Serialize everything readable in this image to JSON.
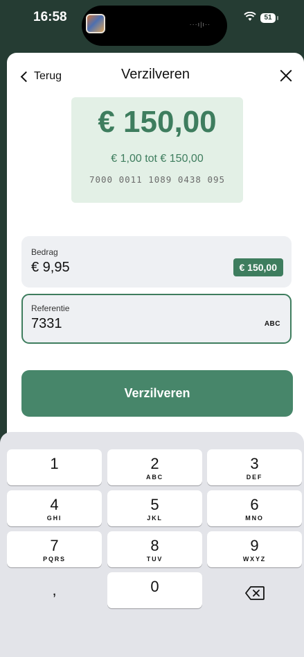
{
  "status_bar": {
    "time": "16:58",
    "battery": "51"
  },
  "nav": {
    "back_label": "Terug",
    "title": "Verzilveren"
  },
  "card": {
    "amount": "€ 150,00",
    "range": "€ 1,00 tot € 150,00",
    "number": "7000 0011 1089 0438 095"
  },
  "amount_field": {
    "label": "Bedrag",
    "value": "€ 9,95",
    "max_label": "€ 150,00"
  },
  "reference_field": {
    "label": "Referentie",
    "value": "7331",
    "keyboard_type": "ABC"
  },
  "submit": {
    "label": "Verzilveren"
  },
  "keyboard": {
    "keys": [
      {
        "digit": "1",
        "letters": ""
      },
      {
        "digit": "2",
        "letters": "ABC"
      },
      {
        "digit": "3",
        "letters": "DEF"
      },
      {
        "digit": "4",
        "letters": "GHI"
      },
      {
        "digit": "5",
        "letters": "JKL"
      },
      {
        "digit": "6",
        "letters": "MNO"
      },
      {
        "digit": "7",
        "letters": "PQRS"
      },
      {
        "digit": "8",
        "letters": "TUV"
      },
      {
        "digit": "9",
        "letters": "WXYZ"
      },
      {
        "digit": "0",
        "letters": ""
      }
    ],
    "comma": ","
  }
}
